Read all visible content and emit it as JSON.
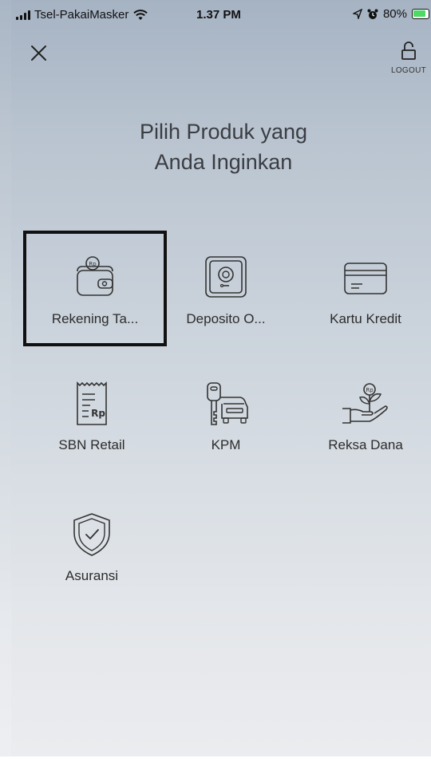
{
  "status_bar": {
    "carrier": "Tsel-PakaiMasker",
    "time": "1.37 PM",
    "battery": "80%"
  },
  "nav": {
    "logout_label": "LOGOUT"
  },
  "headline": {
    "line1": "Pilih Produk yang",
    "line2": "Anda Inginkan"
  },
  "products": [
    {
      "label": "Rekening Ta...",
      "icon": "wallet-icon",
      "selected": true
    },
    {
      "label": "Deposito O...",
      "icon": "safe-icon"
    },
    {
      "label": "Kartu Kredit",
      "icon": "credit-card-icon"
    },
    {
      "label": "SBN Retail",
      "icon": "receipt-icon"
    },
    {
      "label": "KPM",
      "icon": "car-key-icon"
    },
    {
      "label": "Reksa Dana",
      "icon": "hand-plant-icon"
    },
    {
      "label": "Asuransi",
      "icon": "shield-icon"
    }
  ],
  "colors": {
    "battery_fill": "#4cd964",
    "selection_border": "#111111"
  }
}
